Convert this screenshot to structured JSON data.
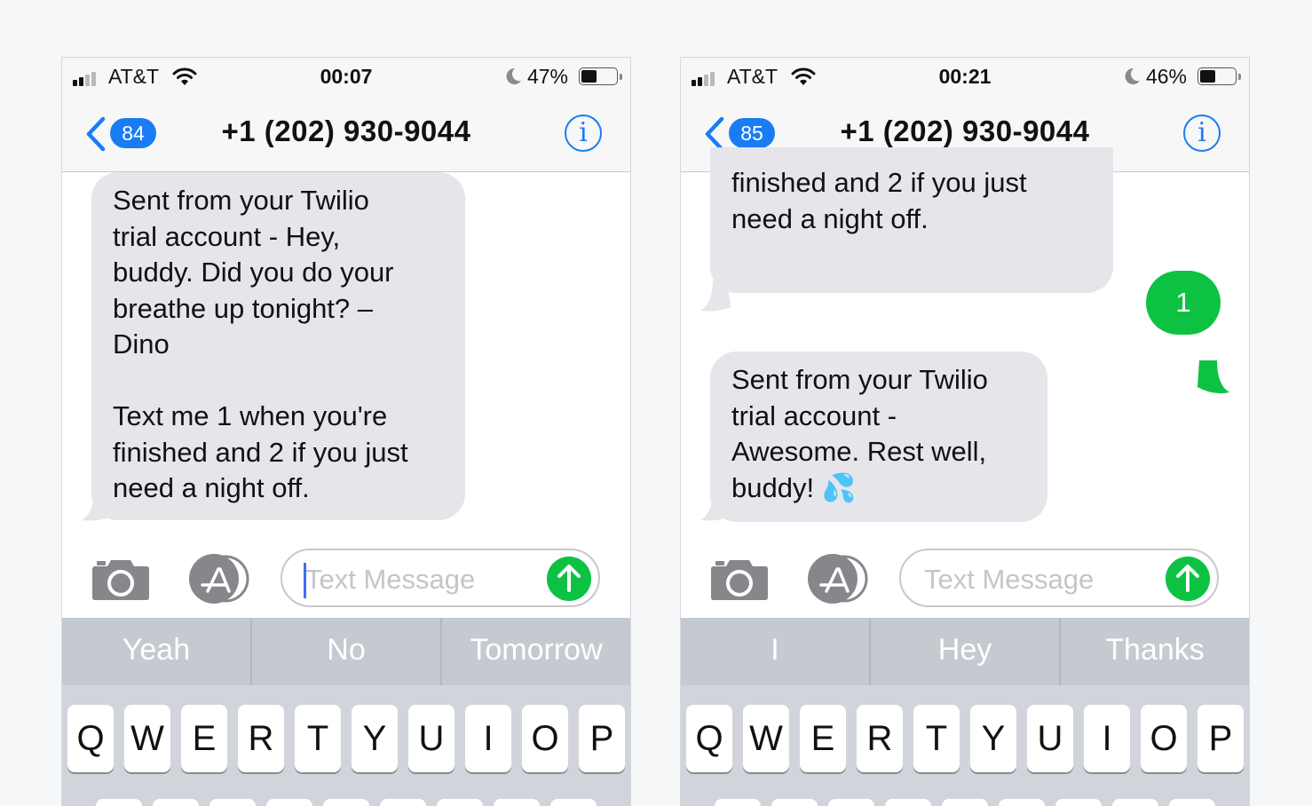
{
  "left": {
    "status": {
      "carrier": "AT&T",
      "time": "00:07",
      "battery": "47%",
      "battery_level": 0.47
    },
    "nav": {
      "back_count": "84",
      "contact": "+1 (202) 930-9044"
    },
    "messages": [
      {
        "from": "contact",
        "text": "Sent from your Twilio\ntrial account - Hey,\nbuddy. Did you do your\nbreathe up tonight? –\nDino\n\nText me 1 when you're\nfinished and 2 if you just\nneed a night off."
      }
    ],
    "input": {
      "placeholder": "Text Message"
    },
    "predictions": [
      "Yeah",
      "No",
      "Tomorrow"
    ]
  },
  "right": {
    "status": {
      "carrier": "AT&T",
      "time": "00:21",
      "battery": "46%",
      "battery_level": 0.46
    },
    "nav": {
      "back_count": "85",
      "contact": "+1 (202) 930-9044"
    },
    "messages": [
      {
        "from": "contact",
        "text": "finished and 2 if you just\nneed a night off."
      },
      {
        "from": "me",
        "text": "1"
      },
      {
        "from": "contact",
        "text": "Sent from your Twilio\ntrial account -\nAwesome. Rest well,\nbuddy! 💦"
      }
    ],
    "input": {
      "placeholder": "Text Message"
    },
    "predictions": [
      "I",
      "Hey",
      "Thanks"
    ]
  },
  "keyboard": {
    "row1": [
      "Q",
      "W",
      "E",
      "R",
      "T",
      "Y",
      "U",
      "I",
      "O",
      "P"
    ]
  },
  "colors": {
    "ios_blue": "#1a7cf3",
    "imessage_green": "#0dc243",
    "bubble_gray": "#e5e5ea"
  }
}
